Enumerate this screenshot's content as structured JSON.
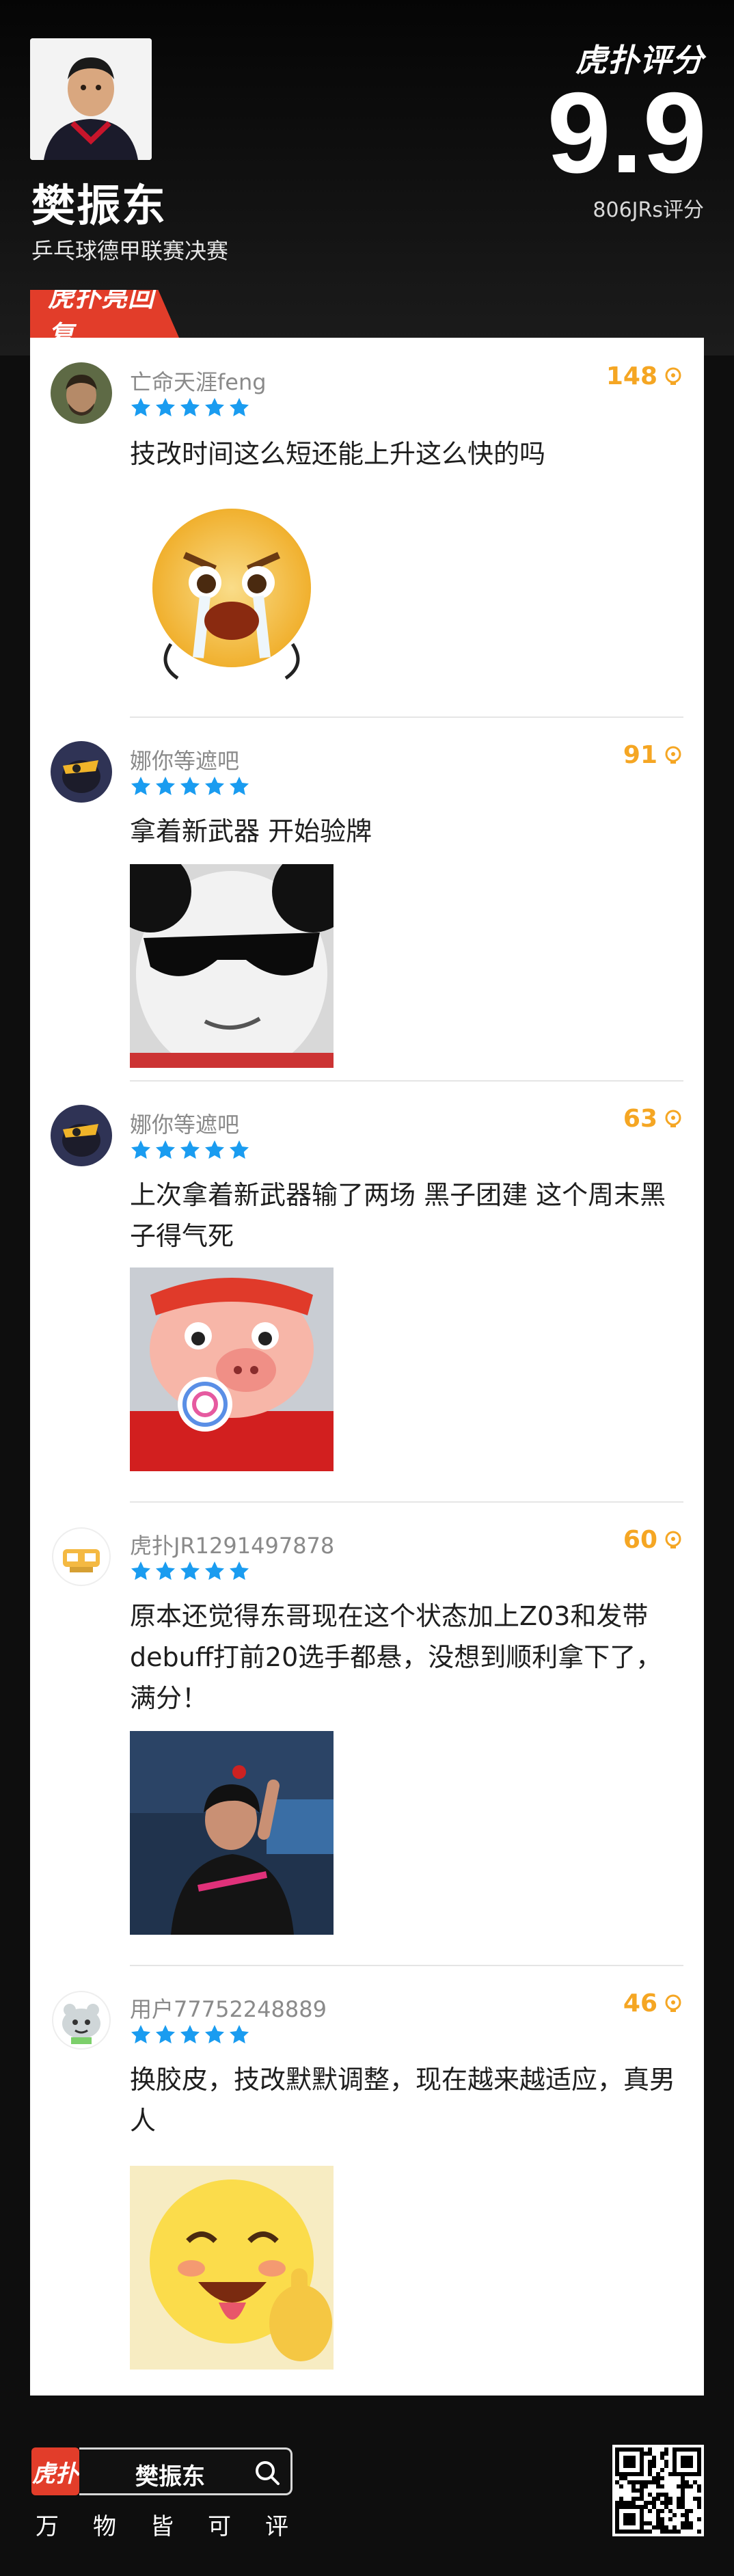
{
  "header": {
    "brand": "虎扑评分",
    "player_name": "樊振东",
    "player_subtitle": "乒乓球德甲联赛决赛",
    "score": "9.9",
    "rating_count": "806JRs评分"
  },
  "section": {
    "tag": "虎扑亮回复"
  },
  "comments": [
    {
      "username": "亡命天涯feng",
      "likes": "148",
      "stars": 5,
      "text": "技改时间这么短还能上升这么快的吗",
      "image": "crying-emoji-sticker"
    },
    {
      "username": "娜你等遮吧",
      "likes": "91",
      "stars": 5,
      "text": "拿着新武器 开始验牌",
      "image": "panda-sunglasses-meme"
    },
    {
      "username": "娜你等遮吧",
      "likes": "63",
      "stars": 5,
      "text": "上次拿着新武器输了两场 黑子团建 这个周末黑子得气死",
      "image": "pig-lollipop-sticker"
    },
    {
      "username": "虎扑JR1291497878",
      "likes": "60",
      "stars": 5,
      "text": "原本还觉得东哥现在这个状态加上Z03和发带debuff打前20选手都悬，没想到顺利拿下了，满分！",
      "image": "player-celebration-photo"
    },
    {
      "username": "用户77752248889",
      "likes": "46",
      "stars": 5,
      "text": "换胶皮，技改默默调整，现在越来越适应，真男人",
      "image": "thumbs-up-emoji-sticker"
    }
  ],
  "footer": {
    "logo": "虎扑",
    "search_text": "樊振东",
    "slogan": [
      "万",
      "物",
      "皆",
      "可",
      "评"
    ]
  },
  "colors": {
    "accent_red": "#e23d2a",
    "like_orange": "#f5a623",
    "star_blue": "#1a9cf0"
  }
}
